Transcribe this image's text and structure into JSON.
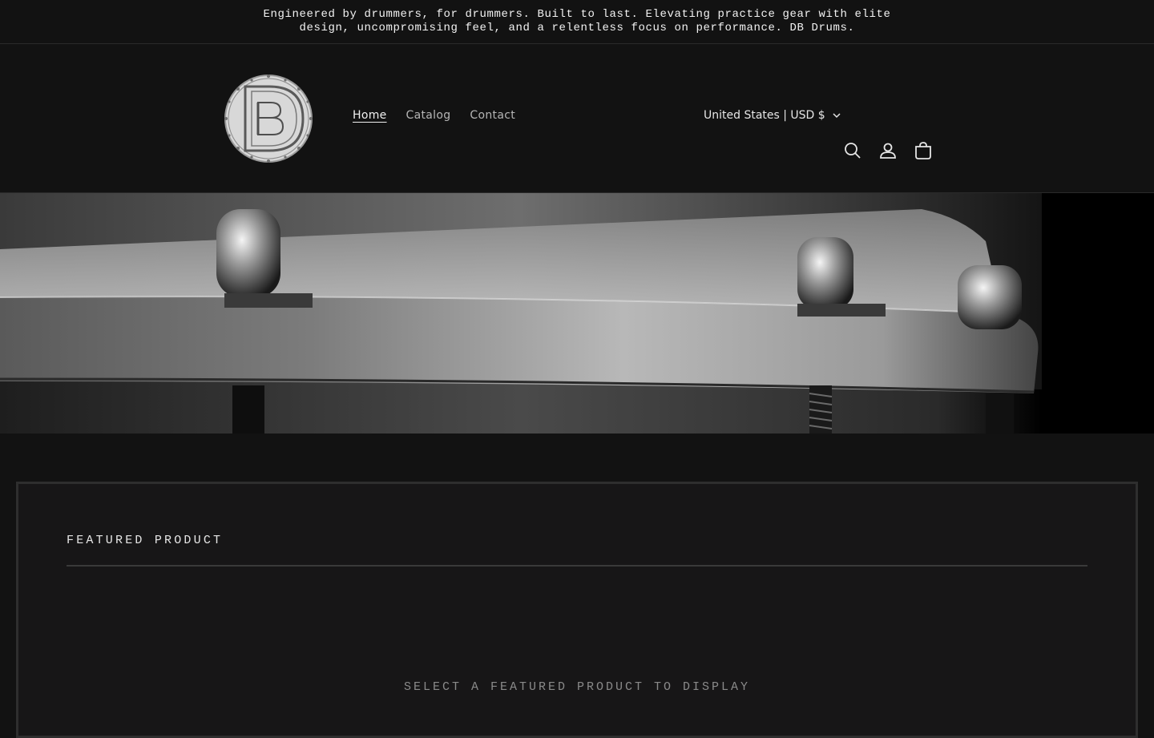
{
  "announcement": {
    "text": "Engineered by drummers, for drummers. Built to last. Elevating practice gear with elite design, uncompromising feel, and a relentless focus on performance. DB Drums."
  },
  "header": {
    "logo_icon": "db-drums-logo",
    "nav": [
      {
        "label": "Home",
        "active": true
      },
      {
        "label": "Catalog",
        "active": false
      },
      {
        "label": "Contact",
        "active": false
      }
    ],
    "country_selector": "United States | USD $",
    "icons": [
      "search-icon",
      "account-icon",
      "cart-icon"
    ]
  },
  "hero": {
    "image": "close-up-snare-drum-hoop-monochrome"
  },
  "featured": {
    "title": "FEATURED PRODUCT",
    "empty_message": "SELECT A FEATURED PRODUCT TO DISPLAY"
  },
  "colors": {
    "background": "#121212",
    "section_background": "#171617",
    "text": "#e8e8e8",
    "muted_text": "#8a8a8a"
  }
}
